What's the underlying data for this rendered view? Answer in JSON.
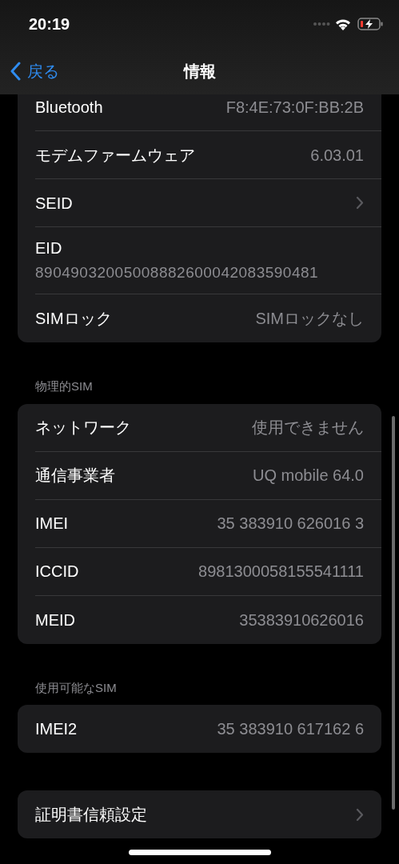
{
  "status_bar": {
    "time": "20:19"
  },
  "nav": {
    "back": "戻る",
    "title": "情報"
  },
  "sections": [
    {
      "cut_top": true,
      "rows": [
        {
          "kind": "value",
          "label": "Bluetooth",
          "value": "F8:4E:73:0F:BB:2B"
        },
        {
          "kind": "value",
          "label": "モデムファームウェア",
          "value": "6.03.01"
        },
        {
          "kind": "link",
          "label": "SEID"
        },
        {
          "kind": "stacked",
          "label": "EID",
          "value": "89049032005008882600042083590481"
        },
        {
          "kind": "value",
          "label": "SIMロック",
          "value": "SIMロックなし"
        }
      ]
    },
    {
      "header": "物理的SIM",
      "rows": [
        {
          "kind": "value",
          "label": "ネットワーク",
          "value": "使用できません"
        },
        {
          "kind": "value",
          "label": "通信事業者",
          "value": "UQ mobile 64.0"
        },
        {
          "kind": "value",
          "label": "IMEI",
          "value": "35 383910 626016 3"
        },
        {
          "kind": "value",
          "label": "ICCID",
          "value": "8981300058155541111"
        },
        {
          "kind": "value",
          "label": "MEID",
          "value": "35383910626016"
        }
      ]
    },
    {
      "header": "使用可能なSIM",
      "rows": [
        {
          "kind": "value",
          "label": "IMEI2",
          "value": "35 383910 617162 6"
        }
      ]
    },
    {
      "rows": [
        {
          "kind": "link",
          "label": "証明書信頼設定"
        }
      ]
    }
  ]
}
